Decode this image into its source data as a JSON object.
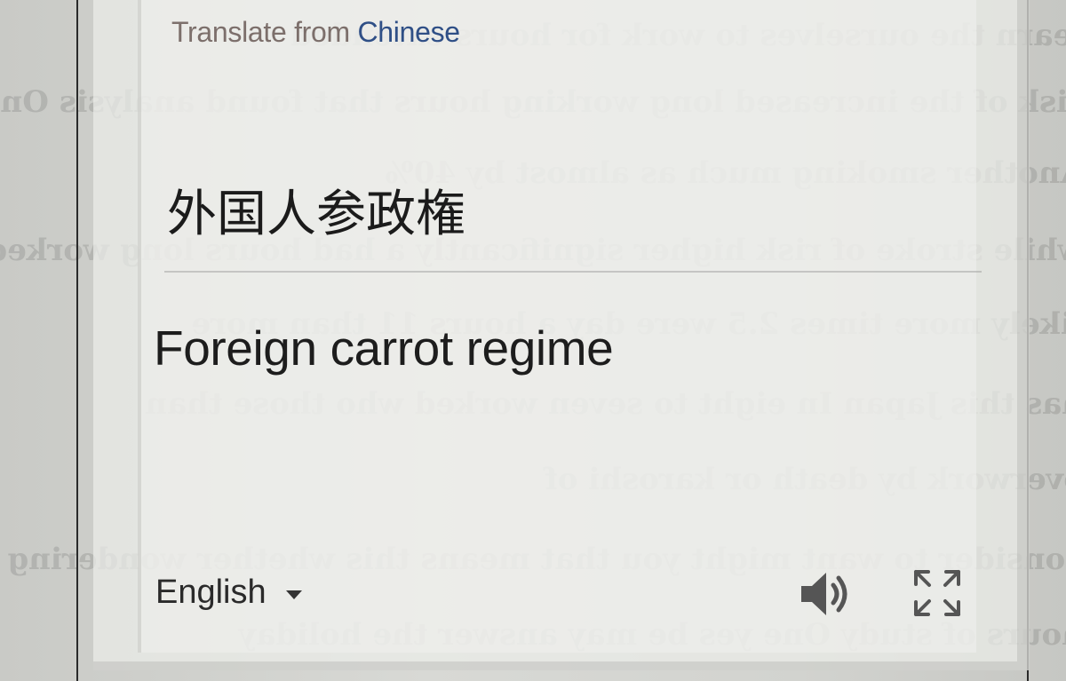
{
  "header": {
    "prefix": "Translate from",
    "source_language": "Chinese"
  },
  "source_text": "外国人参政権",
  "translation_text": "Foreign carrot regime",
  "target_language": {
    "label": "English"
  },
  "icons": {
    "language_dropdown": "caret-down-icon",
    "listen": "speaker-icon",
    "fullscreen": "expand-icon"
  },
  "colors": {
    "header_text": "#7c6f6b",
    "source_language_text": "#2f4f86",
    "main_text": "#1d1d1d"
  }
}
